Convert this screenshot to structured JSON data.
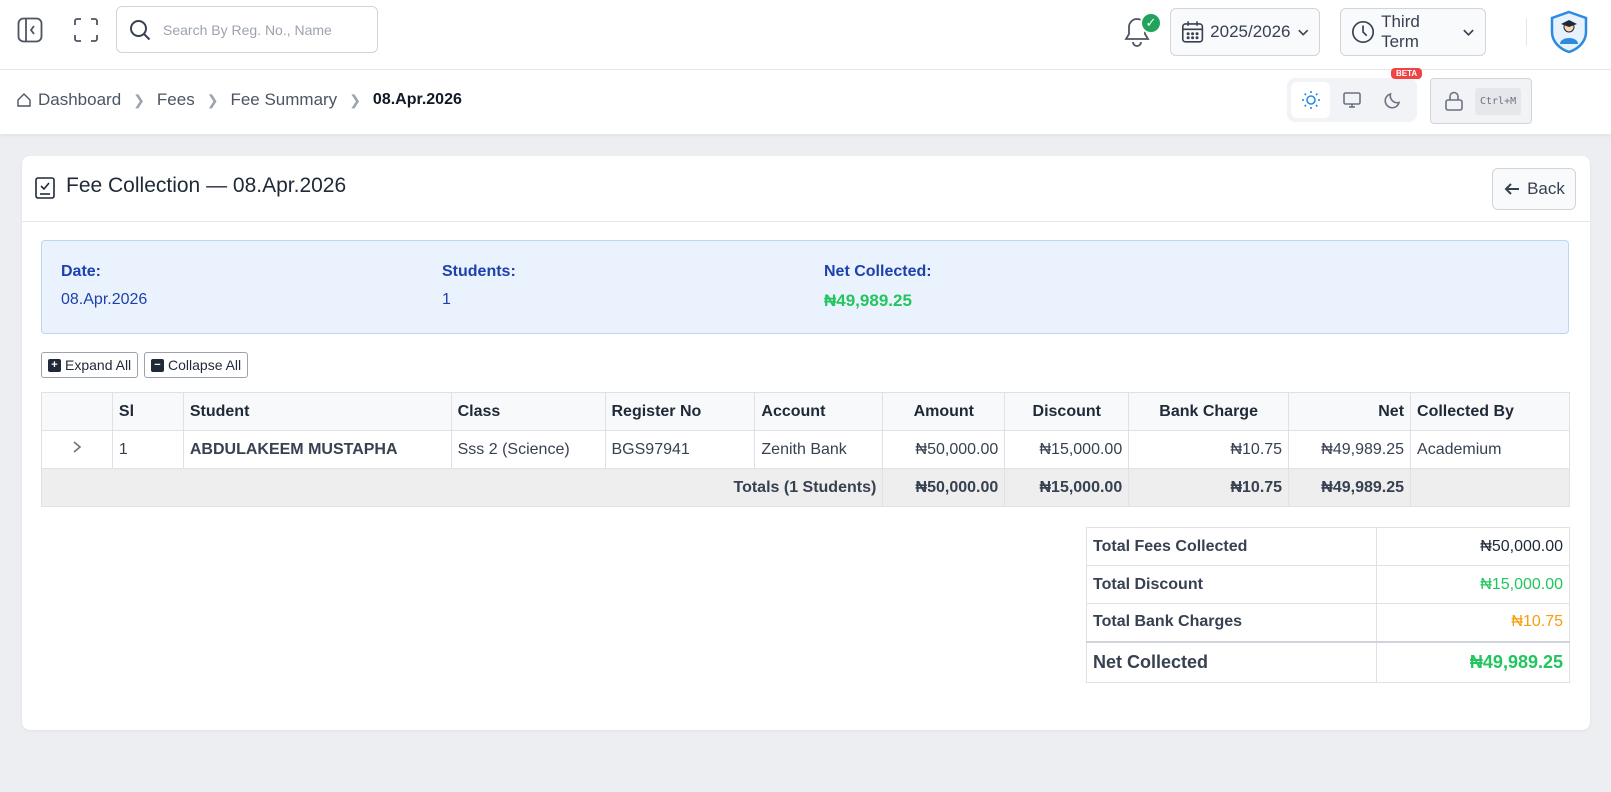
{
  "search": {
    "placeholder": "Search By Reg. No., Name"
  },
  "header": {
    "session": "2025/2026",
    "term": "Third Term",
    "notification_badge": "✓"
  },
  "breadcrumb": {
    "items": [
      "Dashboard",
      "Fees",
      "Fee Summary"
    ],
    "current": "08.Apr.2026"
  },
  "theme": {
    "beta_label": "BETA",
    "shortcut": "Ctrl+M"
  },
  "card": {
    "title": "Fee Collection — 08.Apr.2026",
    "back_label": "Back"
  },
  "info": {
    "date_label": "Date:",
    "date_value": "08.Apr.2026",
    "students_label": "Students:",
    "students_value": "1",
    "net_label": "Net Collected:",
    "net_value": "₦49,989.25"
  },
  "toolbar": {
    "expand_label": "Expand All",
    "collapse_label": "Collapse All"
  },
  "table": {
    "headers": [
      "",
      "Sl",
      "Student",
      "Class",
      "Register No",
      "Account",
      "Amount",
      "Discount",
      "Bank Charge",
      "Net",
      "Collected By"
    ],
    "rows": [
      {
        "sl": "1",
        "student": "ABDULAKEEM MUSTAPHA",
        "class": "Sss 2 (Science)",
        "register_no": "BGS97941",
        "account": "Zenith Bank",
        "amount": "₦50,000.00",
        "discount": "₦15,000.00",
        "bank_charge": "₦10.75",
        "net": "₦49,989.25",
        "collected_by": "Academium"
      }
    ],
    "totals": {
      "label": "Totals (1 Students)",
      "amount": "₦50,000.00",
      "discount": "₦15,000.00",
      "bank_charge": "₦10.75",
      "net": "₦49,989.25"
    }
  },
  "summary": {
    "total_fees_label": "Total Fees Collected",
    "total_fees_value": "₦50,000.00",
    "total_discount_label": "Total Discount",
    "total_discount_value": "₦15,000.00",
    "total_bank_label": "Total Bank Charges",
    "total_bank_value": "₦10.75",
    "net_label": "Net Collected",
    "net_value": "₦49,989.25"
  },
  "colors": {
    "accent": "#2b8ae2",
    "green": "#22c55e",
    "orange": "#f59e0b",
    "info_blue": "#1e40af"
  }
}
